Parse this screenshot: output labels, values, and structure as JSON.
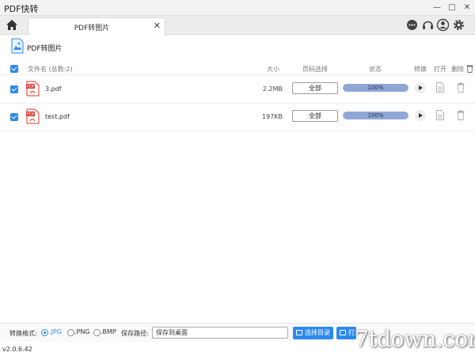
{
  "app": {
    "title": "PDF快转",
    "version": "v2.0.6.42"
  },
  "window": {
    "minimize": "—",
    "maximize": "□",
    "close": "✕"
  },
  "tabs": [
    {
      "label": "PDF转图片",
      "close": "✕"
    }
  ],
  "header_icons": [
    "chat-icon",
    "headset-icon",
    "user-icon",
    "settings-icon"
  ],
  "page": {
    "title": "PDF转图片"
  },
  "table": {
    "columns": {
      "name": "文件名 (总数:2)",
      "size": "大小",
      "pages": "页码选择",
      "status": "状态",
      "convert": "转换",
      "open": "打开",
      "delete": "删除"
    },
    "rows": [
      {
        "name": "3.pdf",
        "size": "2.2MB",
        "pages": "全部",
        "progress_label": "100%",
        "progress": 1.0
      },
      {
        "name": "test.pdf",
        "size": "197KB",
        "pages": "全部",
        "progress_label": "100%",
        "progress": 1.0
      }
    ]
  },
  "bottom": {
    "format_label": "转换格式:",
    "formats": [
      {
        "label": ".JPG",
        "selected": true
      },
      {
        "label": ".PNG",
        "selected": false
      },
      {
        "label": ".BMP",
        "selected": false
      }
    ],
    "save_label": "保存路径:",
    "save_value": "保存到桌面",
    "choose_dir_button": "选择目录",
    "open_button": "打开"
  },
  "watermark": "7tdown.com",
  "colors": {
    "accent": "#2d89ef",
    "progress": "#8fa7d6",
    "pdf_red": "#d9362b"
  }
}
